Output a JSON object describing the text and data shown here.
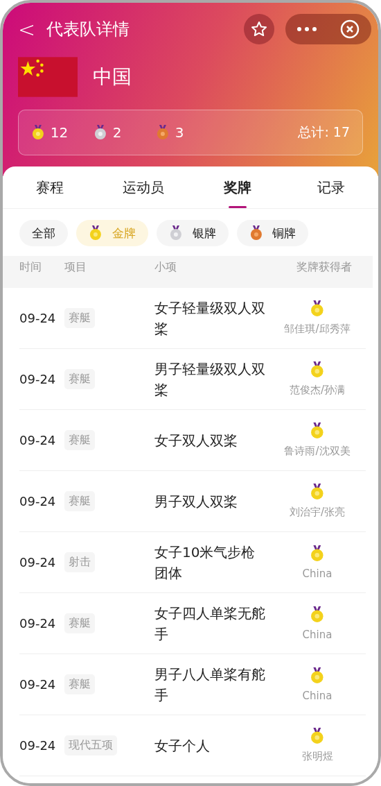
{
  "header": {
    "back": "<",
    "title": "代表队详情"
  },
  "team": {
    "name": "中国"
  },
  "medal_counts": [
    {
      "kind": "gold",
      "count": "12"
    },
    {
      "kind": "silver",
      "count": "2"
    },
    {
      "kind": "bronze",
      "count": "3"
    }
  ],
  "total": "总计: 17",
  "tabs": [
    {
      "label": "赛程",
      "selected": false
    },
    {
      "label": "运动员",
      "selected": false
    },
    {
      "label": "奖牌",
      "selected": true
    },
    {
      "label": "记录",
      "selected": false
    }
  ],
  "filters": [
    {
      "label": "全部",
      "kind": "all",
      "selected": false
    },
    {
      "label": "金牌",
      "kind": "gold",
      "selected": true
    },
    {
      "label": "银牌",
      "kind": "silver",
      "selected": false
    },
    {
      "label": "铜牌",
      "kind": "bronze",
      "selected": false
    }
  ],
  "table": {
    "columns": [
      "时间",
      "项目",
      "小项",
      "奖牌获得者"
    ],
    "rows": [
      {
        "date": "09-24",
        "sport": "赛艇",
        "event": "女子轻量级双人双桨",
        "kind": "gold",
        "winner": "邹佳琪/邱秀萍"
      },
      {
        "date": "09-24",
        "sport": "赛艇",
        "event": "男子轻量级双人双桨",
        "kind": "gold",
        "winner": "范俊杰/孙满"
      },
      {
        "date": "09-24",
        "sport": "赛艇",
        "event": "女子双人双桨",
        "kind": "gold",
        "winner": "鲁诗雨/沈双美"
      },
      {
        "date": "09-24",
        "sport": "赛艇",
        "event": "男子双人双桨",
        "kind": "gold",
        "winner": "刘治宇/张亮"
      },
      {
        "date": "09-24",
        "sport": "射击",
        "event": "女子10米气步枪团体",
        "kind": "gold",
        "winner": "China"
      },
      {
        "date": "09-24",
        "sport": "赛艇",
        "event": "女子四人单桨无舵手",
        "kind": "gold",
        "winner": "China"
      },
      {
        "date": "09-24",
        "sport": "赛艇",
        "event": "男子八人单桨有舵手",
        "kind": "gold",
        "winner": "China"
      },
      {
        "date": "09-24",
        "sport": "现代五项",
        "event": "女子个人",
        "kind": "gold",
        "winner": "张明煜"
      }
    ]
  }
}
